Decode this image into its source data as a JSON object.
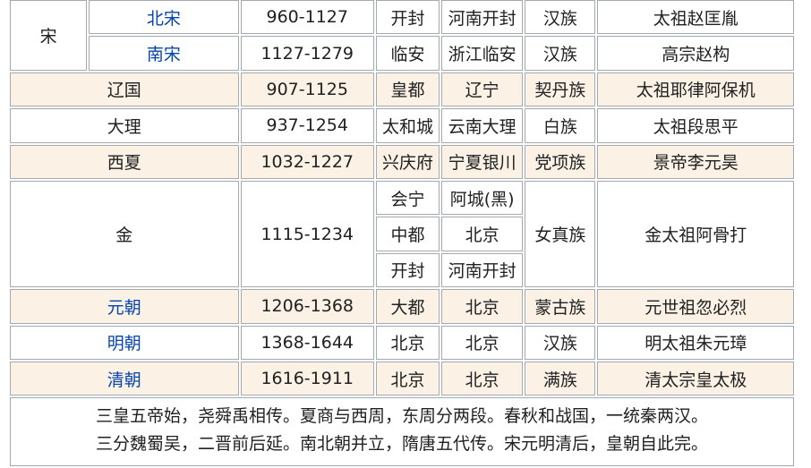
{
  "song": {
    "name": "宋",
    "rows": [
      {
        "dynasty": "北宋",
        "years": "960-1127",
        "capital": "开封",
        "modern": "河南开封",
        "ethnicity": "汉族",
        "founder": "太祖赵匡胤"
      },
      {
        "dynasty": "南宋",
        "years": "1127-1279",
        "capital": "临安",
        "modern": "浙江临安",
        "ethnicity": "汉族",
        "founder": "高宗赵构"
      }
    ]
  },
  "rows": [
    {
      "dynasty": "辽国",
      "years": "907-1125",
      "capital": "皇都",
      "modern": "辽宁",
      "ethnicity": "契丹族",
      "founder": "太祖耶律阿保机"
    },
    {
      "dynasty": "大理",
      "years": "937-1254",
      "capital": "太和城",
      "modern": "云南大理",
      "ethnicity": "白族",
      "founder": "太祖段思平"
    },
    {
      "dynasty": "西夏",
      "years": "1032-1227",
      "capital": "兴庆府",
      "modern": "宁夏银川",
      "ethnicity": "党项族",
      "founder": "景帝李元昊"
    }
  ],
  "jin": {
    "dynasty": "金",
    "years": "1115-1234",
    "ethnicity": "女真族",
    "founder": "金太祖阿骨打",
    "capitals": [
      {
        "capital": "会宁",
        "modern": "阿城(黑)"
      },
      {
        "capital": "中都",
        "modern": "北京"
      },
      {
        "capital": "开封",
        "modern": "河南开封"
      }
    ]
  },
  "later": [
    {
      "dynasty": "元朝",
      "years": "1206-1368",
      "capital": "大都",
      "modern": "北京",
      "ethnicity": "蒙古族",
      "founder": "元世祖忽必烈"
    },
    {
      "dynasty": "明朝",
      "years": "1368-1644",
      "capital": "北京",
      "modern": "北京",
      "ethnicity": "汉族",
      "founder": "明太祖朱元璋"
    },
    {
      "dynasty": "清朝",
      "years": "1616-1911",
      "capital": "北京",
      "modern": "北京",
      "ethnicity": "满族",
      "founder": "清太宗皇太极"
    }
  ],
  "poem": {
    "line1": "三皇五帝始，尧舜禹相传。夏商与西周，东周分两段。春秋和战国，一统秦两汉。",
    "line2": "三分魏蜀吴，二晋前后延。南北朝并立，隋唐五代传。宋元明清后，皇朝自此完。"
  },
  "colors": {
    "link": "#0645ad",
    "shade": "#fbf1e5",
    "border": "#a2a9b1"
  }
}
